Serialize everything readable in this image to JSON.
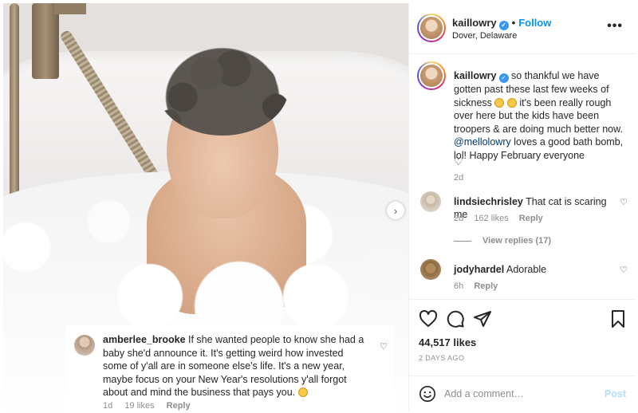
{
  "post": {
    "username": "kaillowry",
    "verified": true,
    "follow_label": "Follow",
    "location": "Dover, Delaware",
    "more_icon": "more-horizontal-icon"
  },
  "photo": {
    "description_icon": "post-photo",
    "next_icon": "chevron-right-icon",
    "next_glyph": "›"
  },
  "overlay_comment": {
    "username": "amberlee_brooke",
    "text": "If she wanted people to know she had a baby she'd announce it. It's getting weird how invested some of y'all are in someone else's life. It's a new year, maybe focus on your New Year's resolutions y'all forgot about and mind the business that pays you.",
    "time": "1d",
    "likes": "19 likes",
    "reply_label": "Reply"
  },
  "caption": {
    "username": "kaillowry",
    "text_part1": "so thankful we have gotten past these last few weeks of sickness",
    "text_part2": "it's been really rough over here but the kids have been troopers & are doing much better now.",
    "mention": "@mellolowry",
    "text_part3": "loves a good bath bomb, lol! Happy February everyone",
    "time": "2d"
  },
  "comments": [
    {
      "username": "lindsiechrisley",
      "text": "That cat is scaring me",
      "time": "2d",
      "likes": "162 likes",
      "reply_label": "Reply"
    },
    {
      "username": "jodyhardel",
      "text": "Adorable",
      "time": "6h",
      "reply_label": "Reply"
    }
  ],
  "view_replies_label": "View replies (17)",
  "engagement": {
    "likes_count": "44,517 likes",
    "post_date": "2 DAYS AGO"
  },
  "add_comment": {
    "placeholder": "Add a comment…",
    "post_label": "Post"
  },
  "colors": {
    "link_blue": "#0095f6",
    "mention": "#00376b",
    "muted": "#8e8e8e",
    "post_disabled": "#b2dffc"
  }
}
